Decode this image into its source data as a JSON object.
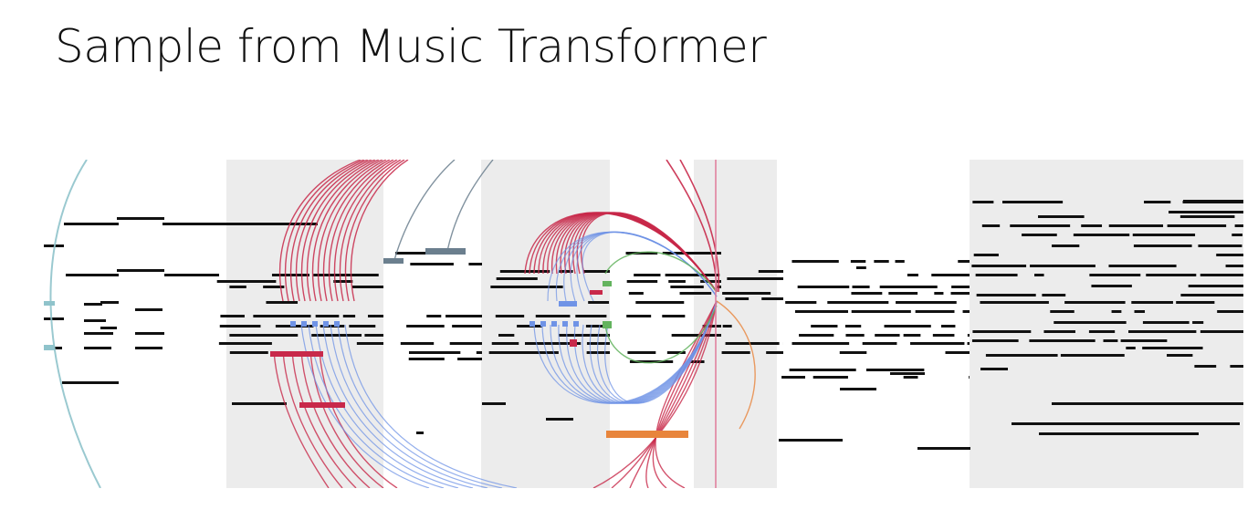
{
  "title": "Sample from Music Transformer",
  "colors": {
    "background": "#ffffff",
    "shading": "#ececec",
    "note": "#111111",
    "attention_red": "#c8294a",
    "attention_blue": "#6f93e6",
    "attention_green": "#63b35e",
    "attention_teal": "#8fc3cb",
    "attention_slate": "#6b7f8e",
    "attention_orange": "#e8853c",
    "playhead": "#e07b9a"
  }
}
